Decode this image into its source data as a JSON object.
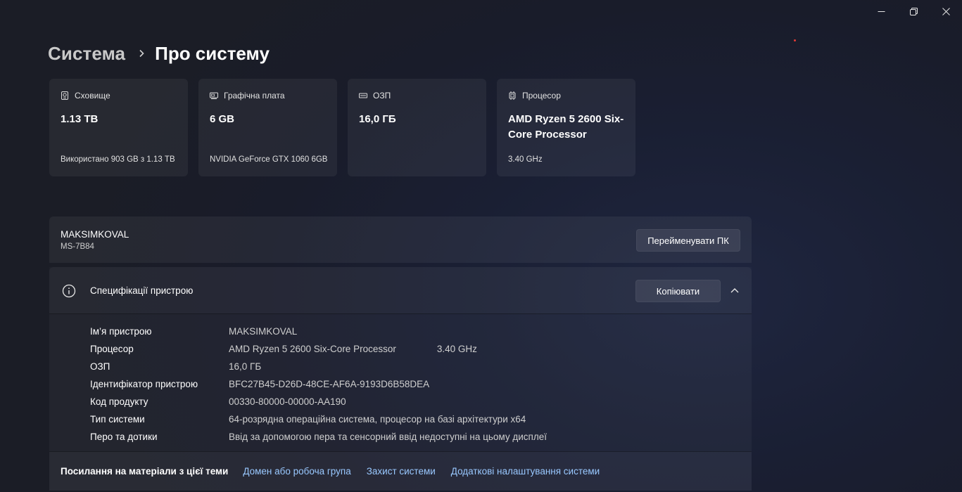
{
  "window": {
    "controls": [
      "minimize-icon",
      "restore-icon",
      "close-icon"
    ]
  },
  "breadcrumb": {
    "parent": "Система",
    "current": "Про систему"
  },
  "cards": [
    {
      "icon": "storage-icon",
      "label": "Сховище",
      "value": "1.13 TB",
      "sub": "Використано 903 GB з 1.13 TB"
    },
    {
      "icon": "graphics-card-icon",
      "label": "Графічна плата",
      "value": "6 GB",
      "sub": "NVIDIA GeForce GTX 1060 6GB"
    },
    {
      "icon": "ram-icon",
      "label": "ОЗП",
      "value": "16,0 ГБ",
      "sub": ""
    },
    {
      "icon": "processor-icon",
      "label": "Процесор",
      "value": "AMD Ryzen 5 2600 Six-Core Processor",
      "sub": "3.40 GHz"
    }
  ],
  "device": {
    "name": "MAKSIMKOVAL",
    "model": "MS-7B84",
    "rename_label": "Перейменувати ПК"
  },
  "specs": {
    "title": "Специфікації пристрою",
    "copy_label": "Копіювати",
    "rows": [
      {
        "label": "Ім’я пристрою",
        "value": "MAKSIMKOVAL",
        "extra": ""
      },
      {
        "label": "Процесор",
        "value": "AMD Ryzen 5 2600 Six-Core Processor",
        "extra": "3.40 GHz"
      },
      {
        "label": "ОЗП",
        "value": "16,0 ГБ",
        "extra": ""
      },
      {
        "label": "Ідентифікатор пристрою",
        "value": "BFC27B45-D26D-48CE-AF6A-9193D6B58DEA",
        "extra": ""
      },
      {
        "label": "Код продукту",
        "value": "00330-80000-00000-AA190",
        "extra": ""
      },
      {
        "label": "Тип системи",
        "value": "64-розрядна операційна система, процесор на базі архітектури x64",
        "extra": ""
      },
      {
        "label": "Перо та дотики",
        "value": "Ввід за допомогою пера та сенсорний ввід недоступні на цьому дисплеї",
        "extra": ""
      }
    ]
  },
  "links": {
    "title": "Посилання на матеріали з цієї теми",
    "items": [
      "Домен або робоча група",
      "Захист системи",
      "Додаткові налаштування системи"
    ]
  },
  "colors": {
    "link": "#99c8ff",
    "accent_dot": "#e53935"
  }
}
